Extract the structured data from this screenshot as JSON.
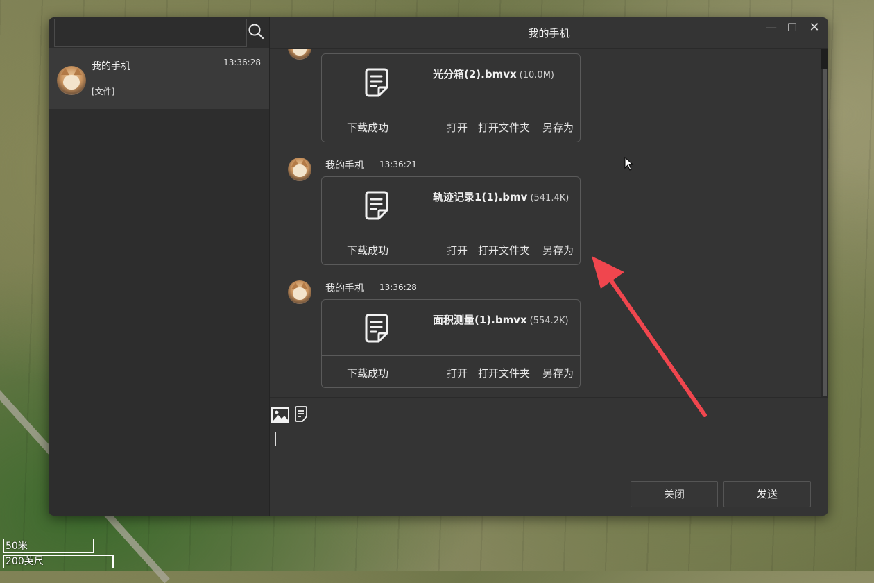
{
  "map": {
    "scale_meters": "50米",
    "scale_feet": "200英尺"
  },
  "window": {
    "title": "我的手机",
    "controls": {
      "minimize": "—",
      "maximize": "☐",
      "close": "✕"
    }
  },
  "sidebar": {
    "search": {
      "placeholder": "",
      "value": ""
    },
    "contacts": [
      {
        "name": "我的手机",
        "time": "13:36:28",
        "preview": "[文件]"
      }
    ]
  },
  "messages": [
    {
      "sender": "",
      "time": "",
      "file_name": "光分箱(2).bmvx",
      "file_size": "(10.0M)",
      "status": "下载成功",
      "actions": [
        "打开",
        "打开文件夹",
        "另存为"
      ]
    },
    {
      "sender": "我的手机",
      "time": "13:36:21",
      "file_name": "轨迹记录1(1).bmv",
      "file_size": "(541.4K)",
      "status": "下载成功",
      "actions": [
        "打开",
        "打开文件夹",
        "另存为"
      ]
    },
    {
      "sender": "我的手机",
      "time": "13:36:28",
      "file_name": "面积测量(1).bmvx",
      "file_size": "(554.2K)",
      "status": "下载成功",
      "actions": [
        "打开",
        "打开文件夹",
        "另存为"
      ]
    }
  ],
  "composer": {
    "value": "",
    "close_label": "关闭",
    "send_label": "发送"
  },
  "colors": {
    "window_bg": "#343434",
    "sidebar_bg": "#2d2d2d",
    "selected_contact_bg": "#3a3a3a",
    "annotation_arrow": "#f0464e"
  }
}
